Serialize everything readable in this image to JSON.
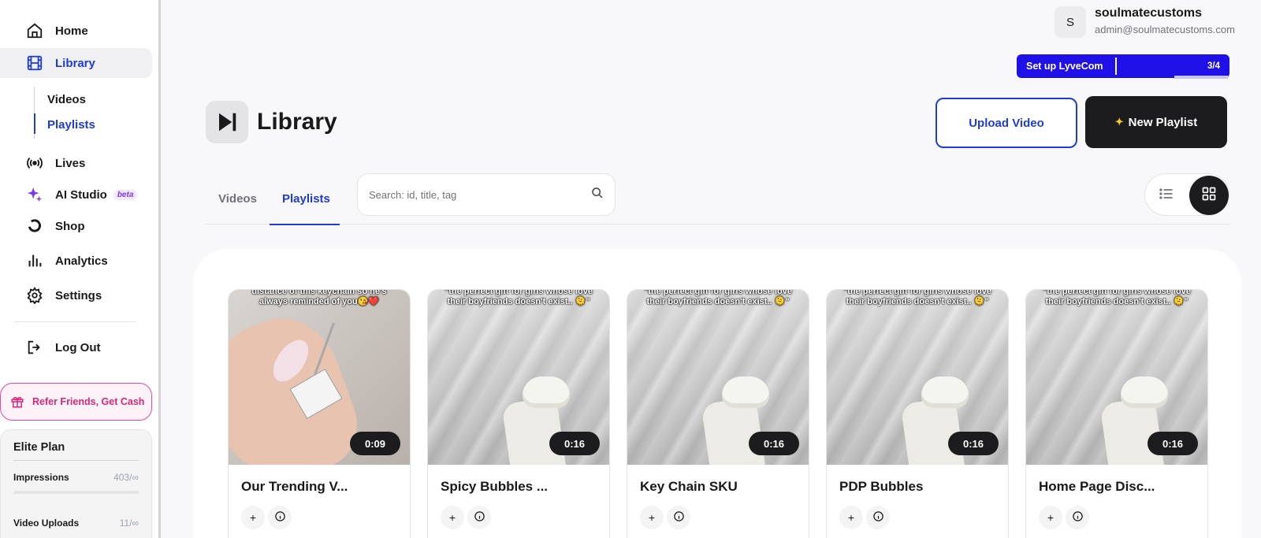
{
  "sidebar": {
    "home_label": "Home",
    "library_label": "Library",
    "sub_videos_label": "Videos",
    "sub_playlists_label": "Playlists",
    "lives_label": "Lives",
    "ai_studio_label": "AI Studio",
    "beta_label": "beta",
    "shop_label": "Shop",
    "analytics_label": "Analytics",
    "settings_label": "Settings",
    "logout_label": "Log Out",
    "refer_label": "Refer Friends, Get Cash",
    "plan": {
      "title": "Elite Plan",
      "impressions_label": "Impressions",
      "impressions_value": "403/∞",
      "uploads_label": "Video Uploads",
      "uploads_value": "11/∞"
    }
  },
  "user": {
    "avatar_initial": "S",
    "name": "soulmatecustoms",
    "email": "admin@soulmatecustoms.com"
  },
  "setup": {
    "label": "Set up LyveCom",
    "progress": "3/4"
  },
  "header": {
    "title": "Library",
    "upload_label": "Upload Video",
    "new_playlist_label": "New Playlist"
  },
  "tabs": {
    "videos_label": "Videos",
    "playlists_label": "Playlists"
  },
  "search": {
    "placeholder": "Search: id, title, tag"
  },
  "playlists": [
    {
      "title": "Our Trending V...",
      "duration": "0:09",
      "caption": "distance of this keychain so he's always reminded of you😘❤️"
    },
    {
      "title": "Spicy Bubbles ...",
      "duration": "0:16",
      "caption": "\"the perfect gift for girls whose love their boyfriends doesn't exist.. 🫠\""
    },
    {
      "title": "Key Chain SKU",
      "duration": "0:16",
      "caption": "\"the perfect gift for girls whose love their boyfriends doesn't exist.. 🫠\""
    },
    {
      "title": "PDP Bubbles",
      "duration": "0:16",
      "caption": "\"the perfect gift for girls whose love their boyfriends doesn't exist.. 🫠\""
    },
    {
      "title": "Home Page Disc...",
      "duration": "0:16",
      "caption": "\"the perfect gift for girls whose love their boyfriends doesn't exist.. 🫠\""
    }
  ],
  "colors": {
    "accent": "#1f3bd8",
    "setup_banner": "#1f10e8",
    "refer": "#db2777",
    "dark": "#1c1c1e"
  }
}
